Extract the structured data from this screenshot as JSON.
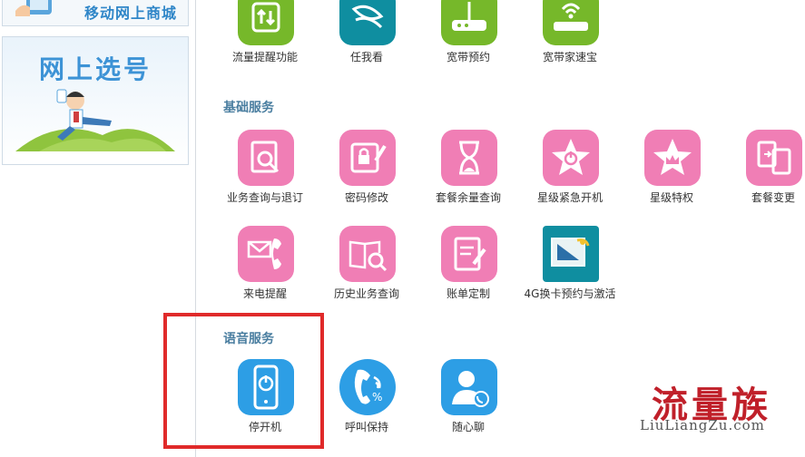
{
  "left_panel": {
    "top_banner_text": "移动网上商城",
    "main_banner_title": "网上选号"
  },
  "top_row": [
    {
      "label": "流量提醒功能",
      "icon": "traffic-alert-icon",
      "color": "#76b82a"
    },
    {
      "label": "任我看",
      "icon": "china-mobile-logo-icon",
      "color": "#0f8ea0"
    },
    {
      "label": "宽带预约",
      "icon": "router-icon",
      "color": "#76b82a"
    },
    {
      "label": "宽带家速宝",
      "icon": "wifi-router-icon",
      "color": "#76b82a"
    }
  ],
  "basic_services": {
    "title": "基础服务",
    "row1": [
      {
        "label": "业务查询与退订",
        "icon": "search-doc-icon"
      },
      {
        "label": "密码修改",
        "icon": "lock-edit-icon"
      },
      {
        "label": "套餐余量查询",
        "icon": "hourglass-icon"
      },
      {
        "label": "星级紧急开机",
        "icon": "star-power-icon"
      },
      {
        "label": "星级特权",
        "icon": "star-crown-icon"
      },
      {
        "label": "套餐变更",
        "icon": "swap-doc-icon"
      }
    ],
    "row2": [
      {
        "label": "来电提醒",
        "icon": "call-mail-icon"
      },
      {
        "label": "历史业务查询",
        "icon": "book-search-icon"
      },
      {
        "label": "账单定制",
        "icon": "bill-edit-icon"
      },
      {
        "label": "4G换卡预约与激活",
        "icon": "sim-card-4g-icon"
      }
    ]
  },
  "voice_services": {
    "title": "语音服务",
    "items": [
      {
        "label": "停开机",
        "icon": "phone-power-icon"
      },
      {
        "label": "呼叫保持",
        "icon": "call-hold-icon"
      },
      {
        "label": "随心聊",
        "icon": "agent-call-icon"
      }
    ]
  },
  "watermark": {
    "logo": "流量族",
    "url": "LiuLiangZu.com"
  },
  "colors": {
    "green": "#76b82a",
    "pink": "#f07eb5",
    "blue": "#2d9ee5",
    "highlight_red": "#e02a2a"
  }
}
